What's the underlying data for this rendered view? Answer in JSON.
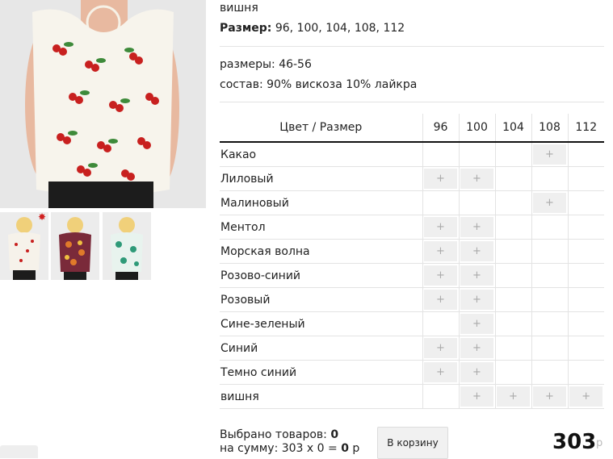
{
  "product": {
    "color_line": "вишня",
    "sizes_label": "Размер:",
    "sizes_value": " 96, 100, 104, 108, 112",
    "meta_sizes": "размеры: 46-56",
    "meta_composition": "состав: 90% вискоза 10% лайкра"
  },
  "grid": {
    "header_label": "Цвет / Размер",
    "sizes": [
      "96",
      "100",
      "104",
      "108",
      "112"
    ],
    "add_symbol": "+",
    "rows": [
      {
        "name": "Какао",
        "avail": [
          false,
          false,
          false,
          true,
          false
        ]
      },
      {
        "name": "Лиловый",
        "avail": [
          true,
          true,
          false,
          false,
          false
        ]
      },
      {
        "name": "Малиновый",
        "avail": [
          false,
          false,
          false,
          true,
          false
        ]
      },
      {
        "name": "Ментол",
        "avail": [
          true,
          true,
          false,
          false,
          false
        ]
      },
      {
        "name": "Морская волна",
        "avail": [
          true,
          true,
          false,
          false,
          false
        ]
      },
      {
        "name": "Розово-синий",
        "avail": [
          true,
          true,
          false,
          false,
          false
        ]
      },
      {
        "name": "Розовый",
        "avail": [
          true,
          true,
          false,
          false,
          false
        ]
      },
      {
        "name": "Сине-зеленый",
        "avail": [
          false,
          true,
          false,
          false,
          false
        ]
      },
      {
        "name": "Синий",
        "avail": [
          true,
          true,
          false,
          false,
          false
        ]
      },
      {
        "name": "Темно синий",
        "avail": [
          true,
          true,
          false,
          false,
          false
        ]
      },
      {
        "name": "вишня",
        "avail": [
          false,
          true,
          true,
          true,
          true
        ]
      }
    ]
  },
  "footer": {
    "selected_label": "Выбрано товаров: ",
    "selected_count": "0",
    "sum_label": "на сумму: 303 x 0 = ",
    "sum_value": "0",
    "sum_currency": " р",
    "cart_button": "В корзину",
    "price": "303",
    "price_currency": "р"
  },
  "icons": {
    "new_badge": "star-icon"
  },
  "colors": {
    "accent_badge": "#d02020",
    "cell_bg": "#efefef"
  }
}
